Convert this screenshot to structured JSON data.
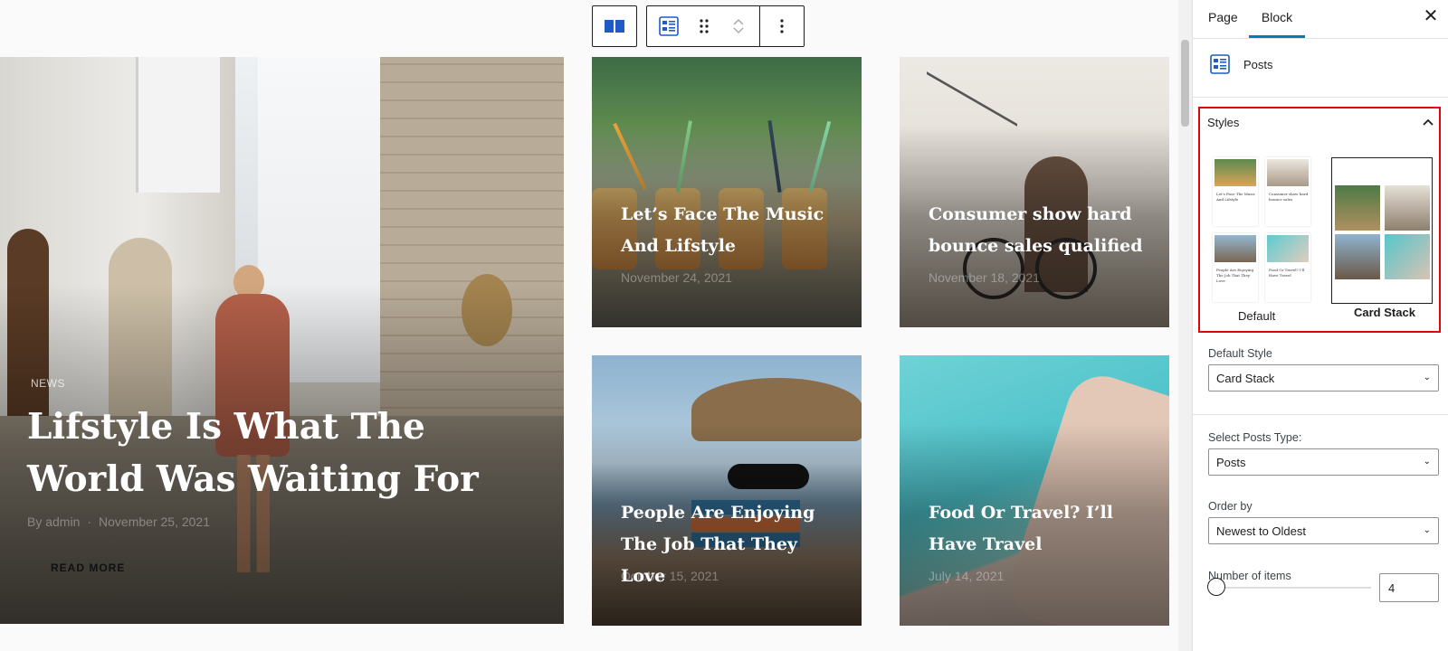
{
  "canvas": {
    "hero": {
      "category": "NEWS",
      "title": "Lifstyle Is What The World Was Waiting For",
      "author": "By admin",
      "date": "November 25, 2021",
      "read_more": "READ MORE"
    },
    "posts": [
      {
        "title": "Let’s Face The Music And Lifstyle",
        "date": "November 24, 2021"
      },
      {
        "title": "Consumer show hard bounce sales qualified",
        "date": "November 18, 2021"
      },
      {
        "title": "People Are Enjoying The Job That They Love",
        "date": "October 15, 2021"
      },
      {
        "title": "Food Or Travel? I’ll Have Travel",
        "date": "July 14, 2021"
      }
    ]
  },
  "toolbar": {
    "icons": [
      "columns-icon",
      "posts-block-icon",
      "drag-handle-icon",
      "move-up-icon",
      "move-down-icon",
      "more-options-icon"
    ]
  },
  "sidebar": {
    "tabs": {
      "page": "Page",
      "block": "Block"
    },
    "close_glyph": "✕",
    "block_name": "Posts",
    "styles": {
      "title": "Styles",
      "options": [
        "Default",
        "Card Stack"
      ],
      "selected": "Card Stack",
      "thumb_titles": [
        "Let's Face The Music And Lifstyle",
        "Consumer show hard bounce sales",
        "People Are Enjoying The Job That They Love",
        "Food Or Travel? I'll Have Travel"
      ]
    },
    "default_style": {
      "label": "Default Style",
      "value": "Card Stack"
    },
    "posts_type": {
      "label": "Select Posts Type:",
      "value": "Posts"
    },
    "order_by": {
      "label": "Order by",
      "value": "Newest to Oldest"
    },
    "number_of_items": {
      "label": "Number of items",
      "value": "4"
    }
  },
  "colors": {
    "accent": "#007cba",
    "highlight_border": "#e1050a"
  }
}
